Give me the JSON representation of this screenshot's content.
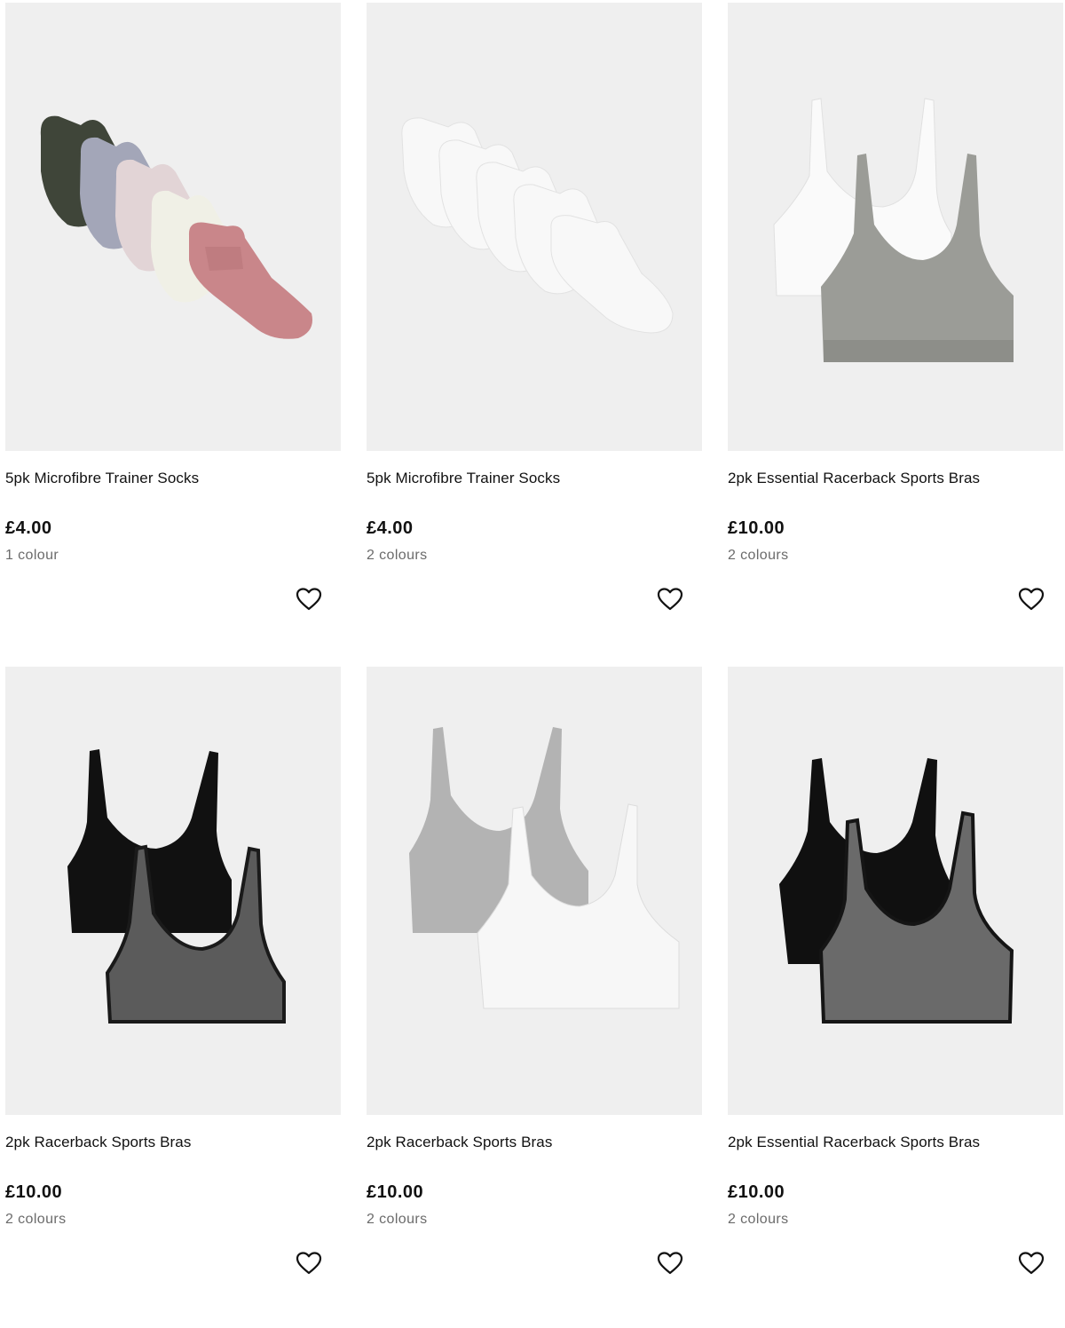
{
  "products": [
    {
      "title": "5pk Microfibre Trainer Socks",
      "price": "£4.00",
      "colours": "1 colour",
      "image_icon": "multicolour-socks-image"
    },
    {
      "title": "5pk Microfibre Trainer Socks",
      "price": "£4.00",
      "colours": "2 colours",
      "image_icon": "white-socks-image"
    },
    {
      "title": "2pk Essential Racerback Sports Bras",
      "price": "£10.00",
      "colours": "2 colours",
      "image_icon": "white-grey-bras-image"
    },
    {
      "title": "2pk Racerback Sports Bras",
      "price": "£10.00",
      "colours": "2 colours",
      "image_icon": "black-charcoal-bras-image"
    },
    {
      "title": "2pk Racerback Sports Bras",
      "price": "£10.00",
      "colours": "2 colours",
      "image_icon": "grey-white-bras-image"
    },
    {
      "title": "2pk Essential Racerback Sports Bras",
      "price": "£10.00",
      "colours": "2 colours",
      "image_icon": "black-grey-bras-image"
    }
  ],
  "colors": {
    "image_background": "#efefef",
    "text": "#111111",
    "muted_text": "#6b6b6b"
  }
}
